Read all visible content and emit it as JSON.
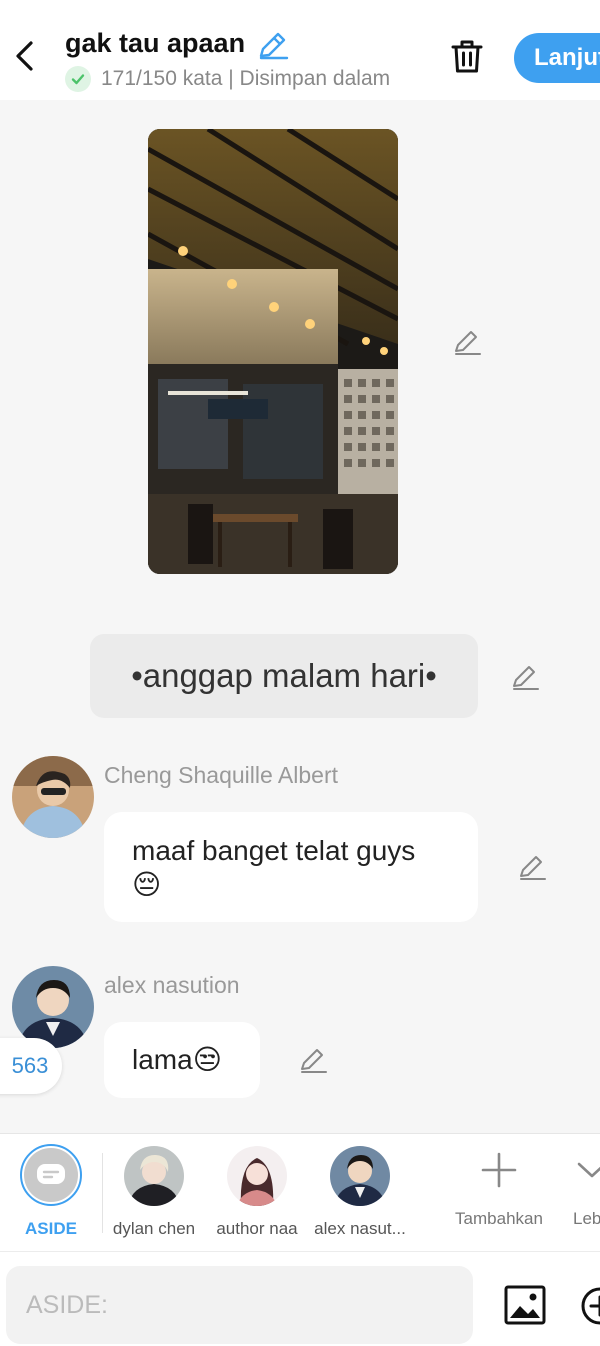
{
  "header": {
    "title": "gak tau apaan",
    "status": "171/150 kata | Disimpan dalam",
    "next_label": "Lanjut"
  },
  "story": {
    "narration": "•anggap malam hari•",
    "messages": [
      {
        "name": "Cheng Shaquille Albert",
        "line1": "maaf banget telat guys",
        "emoji": "😔"
      },
      {
        "name": "alex nasution",
        "text": "lama",
        "emoji": "😒"
      }
    ],
    "counter": "563"
  },
  "charbar": {
    "aside_label": "ASIDE",
    "chars": [
      "dylan chen",
      "author naa",
      "alex nasut..."
    ],
    "add_label": "Tambahkan",
    "more_label": "Lebih"
  },
  "input": {
    "placeholder": "ASIDE:"
  },
  "colors": {
    "accent": "#3ea0f0",
    "check": "#4cc36a"
  }
}
